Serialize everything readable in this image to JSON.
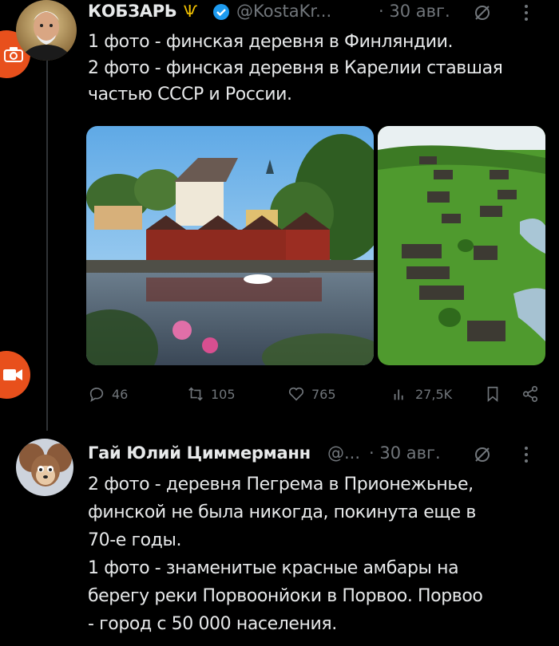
{
  "tweet1": {
    "author": "КОБЗАРЬ",
    "handle": "@KostaKr...",
    "date": "· 30 авг.",
    "lines": [
      "1 фото - финская деревня в Финляндии.",
      "2 фото - финская деревня в Карелии ставшая",
      "частью СССР и России."
    ],
    "actions": {
      "replies": "46",
      "retweets": "105",
      "likes": "765",
      "views": "27,5K"
    }
  },
  "tweet2": {
    "author": "Гай Юлий Циммерманн",
    "handle": "@...",
    "date": "· 30 авг.",
    "lines": [
      "2 фото - деревня Пегрема в Прионежьнье,",
      "финской не была никогда, покинута еще в",
      "70-е годы.",
      "1 фото - знаменитые красные амбары на",
      "берегу реки Порвоонйоки в Порвоо. Порвоо",
      "- город с 50 000 населения."
    ]
  },
  "colors": {
    "background": "#000000",
    "text": "#e7e9ea",
    "muted": "#71767b",
    "verified": "#1d9bf0",
    "floating_button": "#e8501c"
  },
  "icons": [
    "camera-icon",
    "video-icon",
    "verified-badge-icon",
    "trident-emoji-icon",
    "grok-icon",
    "more-icon",
    "reply-icon",
    "retweet-icon",
    "like-icon",
    "views-icon",
    "bookmark-icon",
    "share-icon"
  ]
}
